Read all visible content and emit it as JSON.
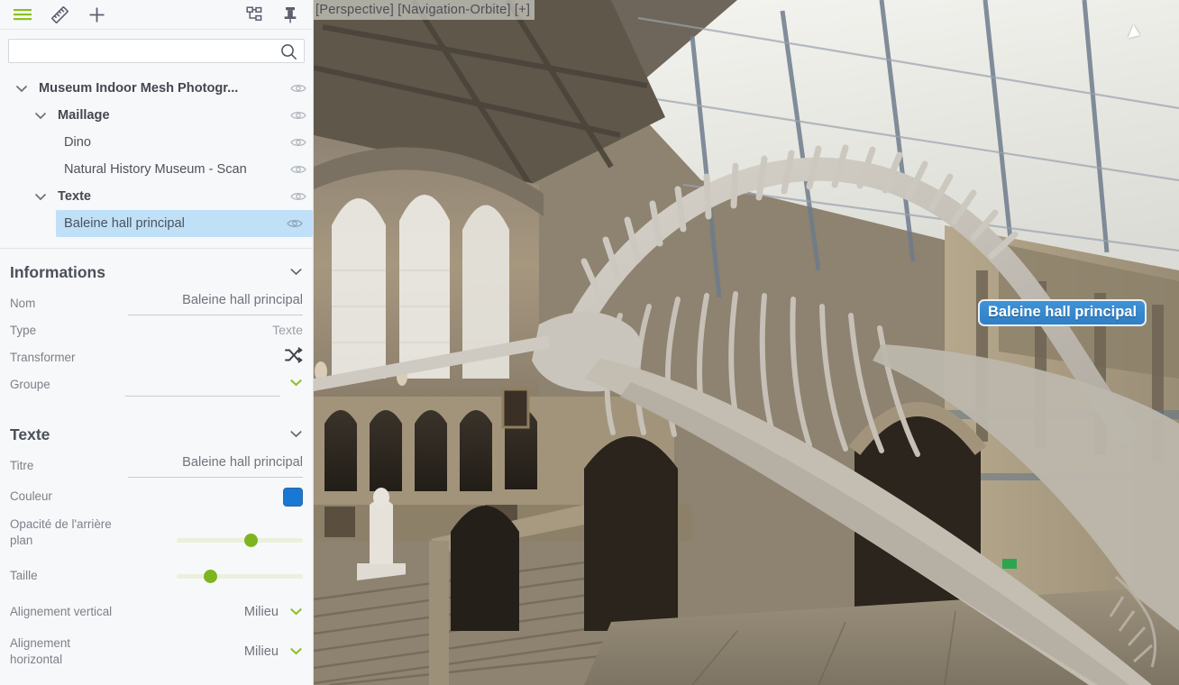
{
  "toolbar": {
    "menu_icon": "hamburger-menu-icon",
    "measure_icon": "ruler-measure-icon",
    "add_icon": "plus-add-icon",
    "hierarchy_icon": "tree-hierarchy-icon",
    "pin_icon": "pushpin-icon"
  },
  "search": {
    "value": "",
    "placeholder": "",
    "icon": "search-icon"
  },
  "tree": {
    "items": [
      {
        "label": "Museum Indoor Mesh Photogr...",
        "depth": 0,
        "bold": true,
        "expanded": true,
        "selected": false,
        "visibility_icon": "eye-icon"
      },
      {
        "label": "Maillage",
        "depth": 1,
        "bold": true,
        "expanded": true,
        "selected": false,
        "visibility_icon": "eye-icon"
      },
      {
        "label": "Dino",
        "depth": 2,
        "bold": false,
        "expanded": null,
        "selected": false,
        "visibility_icon": "eye-icon"
      },
      {
        "label": "Natural History Museum - Scan",
        "depth": 2,
        "bold": false,
        "expanded": null,
        "selected": false,
        "visibility_icon": "eye-icon"
      },
      {
        "label": "Texte",
        "depth": 1,
        "bold": true,
        "expanded": true,
        "selected": false,
        "visibility_icon": "eye-icon"
      },
      {
        "label": "Baleine hall principal",
        "depth": 2,
        "bold": false,
        "expanded": null,
        "selected": true,
        "visibility_icon": "eye-icon"
      }
    ]
  },
  "informations": {
    "title": "Informations",
    "collapse_icon": "chevron-down-icon",
    "nom_label": "Nom",
    "nom_value": "Baleine hall principal",
    "type_label": "Type",
    "type_value": "Texte",
    "transformer_label": "Transformer",
    "transformer_icon": "shuffle-transform-icon",
    "groupe_label": "Groupe",
    "groupe_value": "",
    "groupe_chevron_icon": "chevron-down-icon"
  },
  "texte": {
    "title": "Texte",
    "collapse_icon": "chevron-down-icon",
    "titre_label": "Titre",
    "titre_value": "Baleine hall principal",
    "couleur_label": "Couleur",
    "couleur_value": "#1878d4",
    "opacite_label": "Opacité de l'arrière plan",
    "opacite_percent": 60,
    "taille_label": "Taille",
    "taille_percent": 24,
    "align_vertical_label": "Alignement vertical",
    "align_vertical_value": "Milieu",
    "align_horizontal_label": "Alignement horizontal",
    "align_horizontal_value": "Milieu",
    "dropdown_icon": "chevron-down-icon"
  },
  "viewport": {
    "overlay_text": "[Perspective]  [Navigation-Orbite]  [+]",
    "scene_label": "Baleine hall principal",
    "cursor_icon": "arrow-cursor-icon"
  },
  "colors": {
    "accent_green": "#7eb41f",
    "selection_blue": "#bfe0f7",
    "label_blue": "#1878d4",
    "panel_bg": "#f7f8f9"
  }
}
